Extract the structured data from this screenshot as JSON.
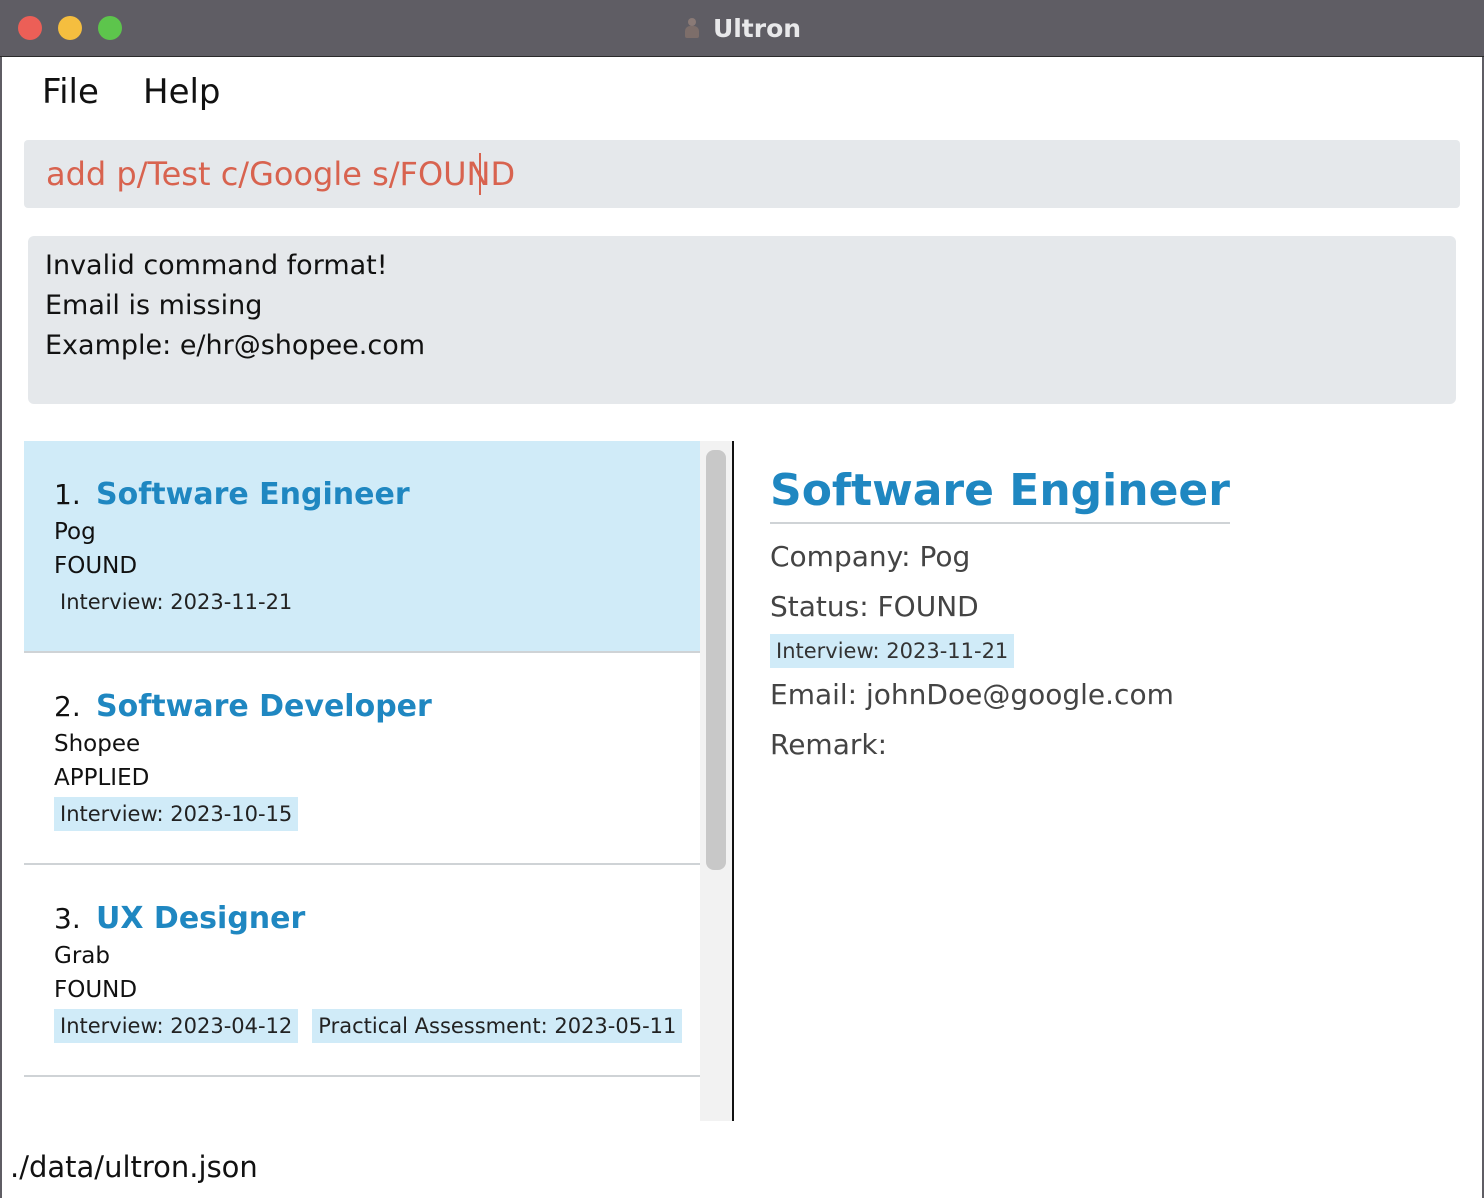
{
  "window": {
    "title": "Ultron"
  },
  "menu": {
    "file": "File",
    "help": "Help"
  },
  "command": {
    "value": "add p/Test c/Google s/FOUND"
  },
  "result": {
    "lines": [
      "Invalid command format!",
      "Email is missing",
      "Example: e/hr@shopee.com"
    ]
  },
  "openings": [
    {
      "index": "1.",
      "role": "Software Engineer",
      "company": "Pog",
      "status": "FOUND",
      "events": [
        "Interview: 2023-11-21"
      ],
      "selected": true
    },
    {
      "index": "2.",
      "role": "Software Developer",
      "company": "Shopee",
      "status": "APPLIED",
      "events": [
        "Interview: 2023-10-15"
      ],
      "selected": false
    },
    {
      "index": "3.",
      "role": "UX Designer",
      "company": "Grab",
      "status": "FOUND",
      "events": [
        "Interview: 2023-04-12",
        "Practical Assessment: 2023-05-11"
      ],
      "selected": false
    }
  ],
  "detail": {
    "title": "Software Engineer",
    "company": "Company: Pog",
    "status": "Status: FOUND",
    "event": "Interview: 2023-11-21",
    "email": "Email: johnDoe@google.com",
    "remark": "Remark:"
  },
  "status_bar": {
    "path": "./data/ultron.json"
  },
  "colors": {
    "accent": "#1f87c1",
    "command_text": "#d8634f",
    "selected_bg": "#d0ebf8",
    "panel_bg": "#e5e8eb"
  }
}
